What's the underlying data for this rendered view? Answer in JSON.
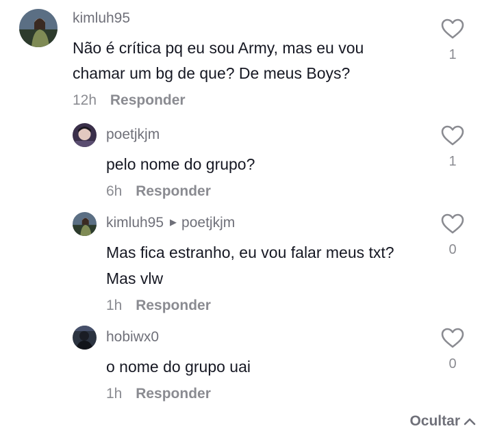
{
  "comments": [
    {
      "username": "kimluh95",
      "reply_to": "",
      "lines": [
        "Não é crítica pq eu sou Army, mas eu vou",
        "chamar um bg de que? De meus Boys?"
      ],
      "time": "12h",
      "reply_label": "Responder",
      "likes": "1",
      "avatar": "avatar-kimluh95"
    },
    {
      "username": "poetjkjm",
      "reply_to": "",
      "lines": [
        "pelo nome do grupo?"
      ],
      "time": "6h",
      "reply_label": "Responder",
      "likes": "1",
      "avatar": "avatar-poetjkjm"
    },
    {
      "username": "kimluh95",
      "reply_to": "poetjkjm",
      "lines": [
        "Mas fica estranho, eu vou falar meus txt?",
        "Mas vlw"
      ],
      "time": "1h",
      "reply_label": "Responder",
      "likes": "0",
      "avatar": "avatar-kimluh95"
    },
    {
      "username": "hobiwx0",
      "reply_to": "",
      "lines": [
        "o nome do grupo uai"
      ],
      "time": "1h",
      "reply_label": "Responder",
      "likes": "0",
      "avatar": "avatar-hobiwx0"
    }
  ],
  "hide_label": "Ocultar",
  "icons": {
    "like": "heart-outline-icon",
    "hide": "chevron-up-icon",
    "reply_arrow": "triangle-right-icon"
  },
  "colors": {
    "text": "#161823",
    "secondary": "#8a8b91",
    "username": "#6f7079"
  }
}
